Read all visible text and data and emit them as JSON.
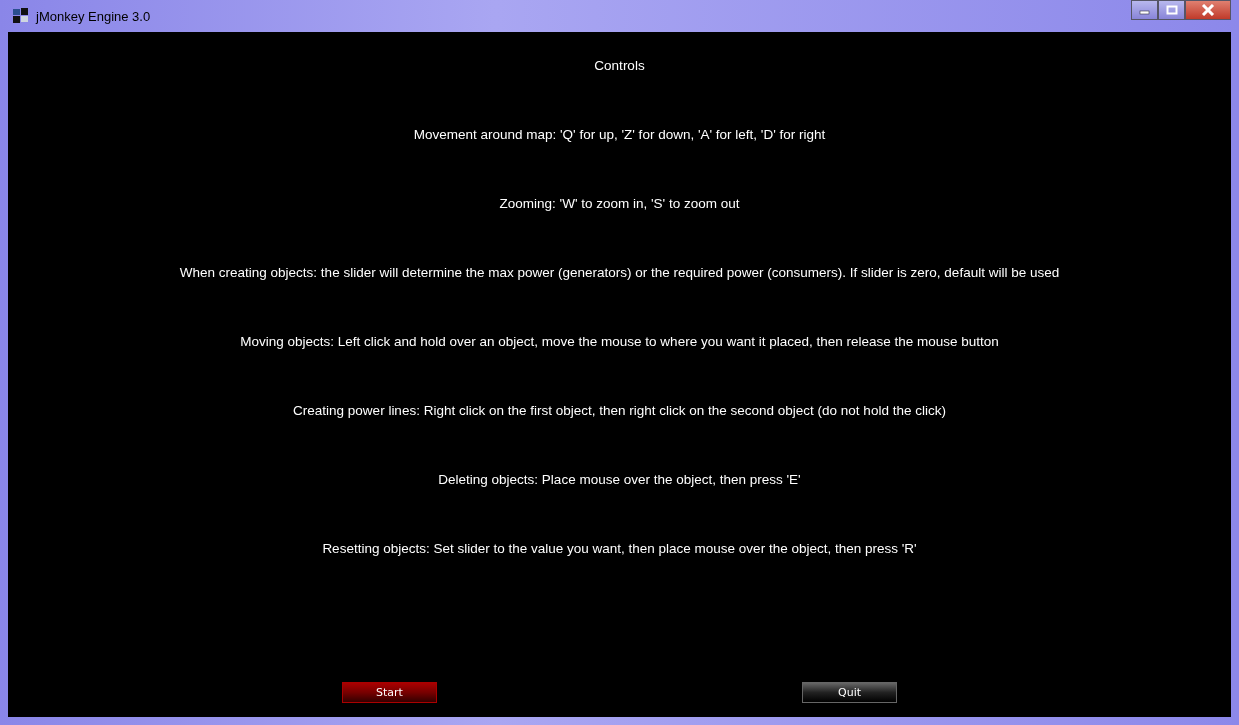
{
  "window": {
    "title": "jMonkey Engine 3.0"
  },
  "heading": "Controls",
  "lines": [
    "Movement around map: 'Q' for up, 'Z' for down, 'A' for left, 'D' for right",
    "Zooming: 'W' to zoom in, 'S' to zoom out",
    "When creating objects: the slider will determine the max power (generators) or the required power (consumers). If slider is zero, default will be used",
    "Moving objects: Left click and hold over an object, move the mouse to where you want it placed, then release the mouse button",
    "Creating power lines: Right click on the first object, then right click on the second object (do not hold the click)",
    "Deleting objects: Place mouse over the object, then press 'E'",
    "Resetting objects: Set slider to the value you want, then place mouse over the object, then press 'R'"
  ],
  "buttons": [
    {
      "label": "Start",
      "selected": true
    },
    {
      "label": "Quit",
      "selected": false
    }
  ]
}
